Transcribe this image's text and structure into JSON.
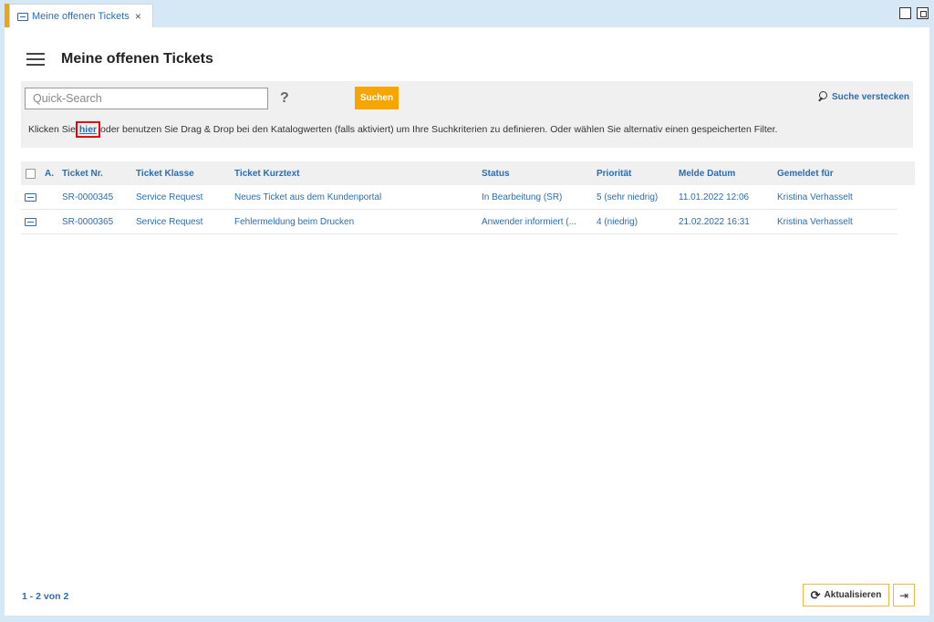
{
  "tab": {
    "title": "Meine offenen Tickets",
    "close": "×"
  },
  "header": {
    "title": "Meine offenen Tickets"
  },
  "search": {
    "placeholder": "Quick-Search",
    "help": "?",
    "submit_label": "Suchen",
    "hide_label": "Suche verstecken",
    "hint_before": "Klicken Sie ",
    "hint_link": "hier",
    "hint_after": " oder benutzen Sie Drag & Drop bei den Katalogwerten (falls aktiviert) um Ihre Suchkriterien zu definieren. Oder wählen Sie alternativ einen gespeicherten Filter."
  },
  "table": {
    "headers": [
      "A.",
      "Ticket Nr.",
      "Ticket Klasse",
      "Ticket Kurztext",
      "Status",
      "Priorität",
      "Melde Datum",
      "Gemeldet für"
    ],
    "rows": [
      {
        "ticket_nr": "SR-0000345",
        "klasse": "Service Request",
        "kurztext": "Neues Ticket aus dem Kundenportal",
        "status": "In Bearbeitung (SR)",
        "prioritaet": "5 (sehr niedrig)",
        "datum": "11.01.2022 12:06",
        "gemeldet_fuer": "Kristina  Verhasselt"
      },
      {
        "ticket_nr": "SR-0000365",
        "klasse": "Service Request",
        "kurztext": "Fehlermeldung beim Drucken",
        "status": "Anwender informiert (...",
        "prioritaet": "4 (niedrig)",
        "datum": "21.02.2022 16:31",
        "gemeldet_fuer": "Kristina  Verhasselt"
      }
    ]
  },
  "footer": {
    "pager": "1 - 2 von 2",
    "refresh_label": "Aktualisieren"
  },
  "colors": {
    "accent": "#f7a600",
    "link": "#2a6db3",
    "background": "#d6e8f5"
  }
}
